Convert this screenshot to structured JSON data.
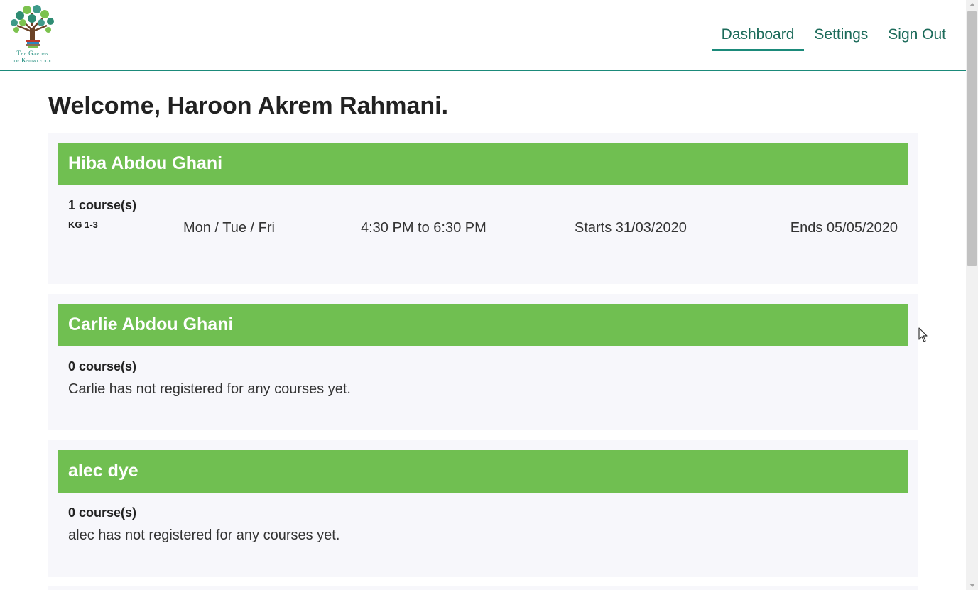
{
  "header": {
    "logo_line1": "The Garden",
    "logo_line2": "of Knowledge",
    "nav": [
      {
        "label": "Dashboard",
        "active": true
      },
      {
        "label": "Settings"
      },
      {
        "label": "Sign Out"
      }
    ]
  },
  "welcome": "Welcome, Haroon Akrem Rahmani.",
  "students": [
    {
      "name": "Hiba Abdou Ghani",
      "course_count": "1 course(s)",
      "course_code": "KG 1-3",
      "days": "Mon / Tue / Fri",
      "time": "4:30 PM to 6:30 PM",
      "starts": "Starts 31/03/2020",
      "ends": "Ends 05/05/2020"
    },
    {
      "name": "Carlie Abdou Ghani",
      "course_count": "0 course(s)",
      "message": "Carlie has not registered for any courses yet."
    },
    {
      "name": "alec dye",
      "course_count": "0 course(s)",
      "message": "alec has not registered for any courses yet."
    }
  ],
  "colors": {
    "accent": "#1b8a7a",
    "nav_text": "#1c6b5a",
    "student_header": "#70bf51",
    "card_background": "#f7f7fb"
  },
  "icons": {
    "logo": "tree-logo-icon",
    "cursor": "mouse-pointer-icon"
  }
}
